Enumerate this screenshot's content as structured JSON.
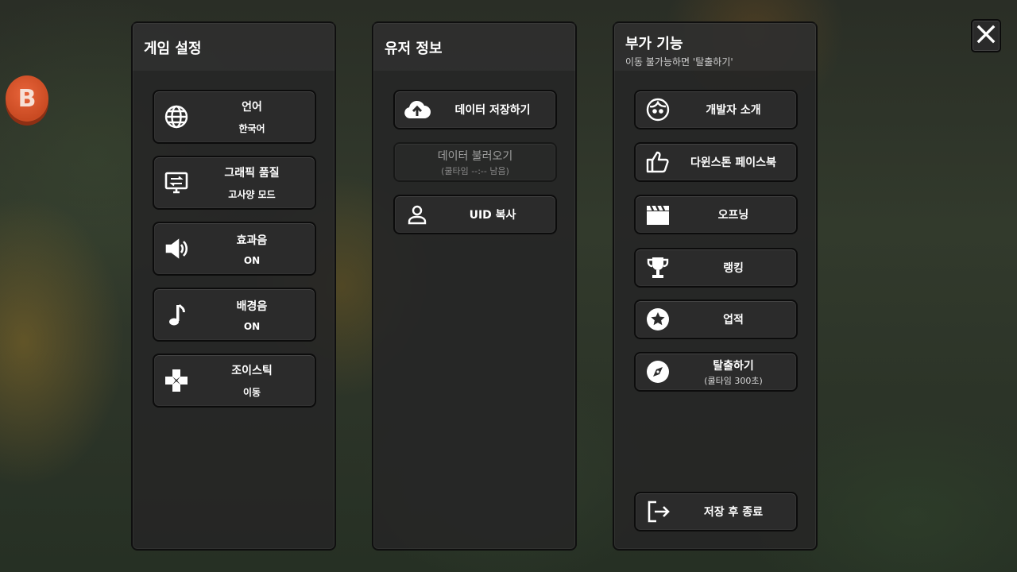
{
  "colors": {
    "panel_bg": "#262626",
    "button_bg": "#2b2b2b",
    "badge": "#d9552c"
  },
  "badge": {
    "letter": "B"
  },
  "close": {
    "icon": "close-icon"
  },
  "game_settings": {
    "title": "게임 설정",
    "items": [
      {
        "label": "언어",
        "value": "한국어",
        "icon": "globe-icon"
      },
      {
        "label": "그래픽 품질",
        "value": "고사양 모드",
        "icon": "monitor-icon"
      },
      {
        "label": "효과음",
        "value": "ON",
        "icon": "speaker-icon"
      },
      {
        "label": "배경음",
        "value": "ON",
        "icon": "music-note-icon"
      },
      {
        "label": "조이스틱",
        "value": "이동",
        "icon": "dpad-icon"
      }
    ]
  },
  "user_info": {
    "title": "유저 정보",
    "save": {
      "label": "데이터 저장하기",
      "icon": "cloud-upload-icon"
    },
    "load": {
      "label": "데이터 불러오기",
      "sub": "(쿨타임 --:-- 남음)"
    },
    "uid": {
      "label": "UID 복사",
      "icon": "person-icon"
    }
  },
  "extras": {
    "title": "부가 기능",
    "subtitle": "이동 불가능하면 '탈출하기'",
    "items": [
      {
        "label": "개발자 소개",
        "icon": "face-icon"
      },
      {
        "label": "다윈스톤 페이스북",
        "icon": "thumbs-up-icon"
      },
      {
        "label": "오프닝",
        "icon": "clapperboard-icon"
      },
      {
        "label": "랭킹",
        "icon": "trophy-icon"
      },
      {
        "label": "업적",
        "icon": "star-icon"
      },
      {
        "label": "탈출하기",
        "sub": "(쿨타임 300초)",
        "icon": "compass-icon"
      }
    ],
    "quit": {
      "label": "저장 후 종료",
      "icon": "exit-icon"
    }
  }
}
